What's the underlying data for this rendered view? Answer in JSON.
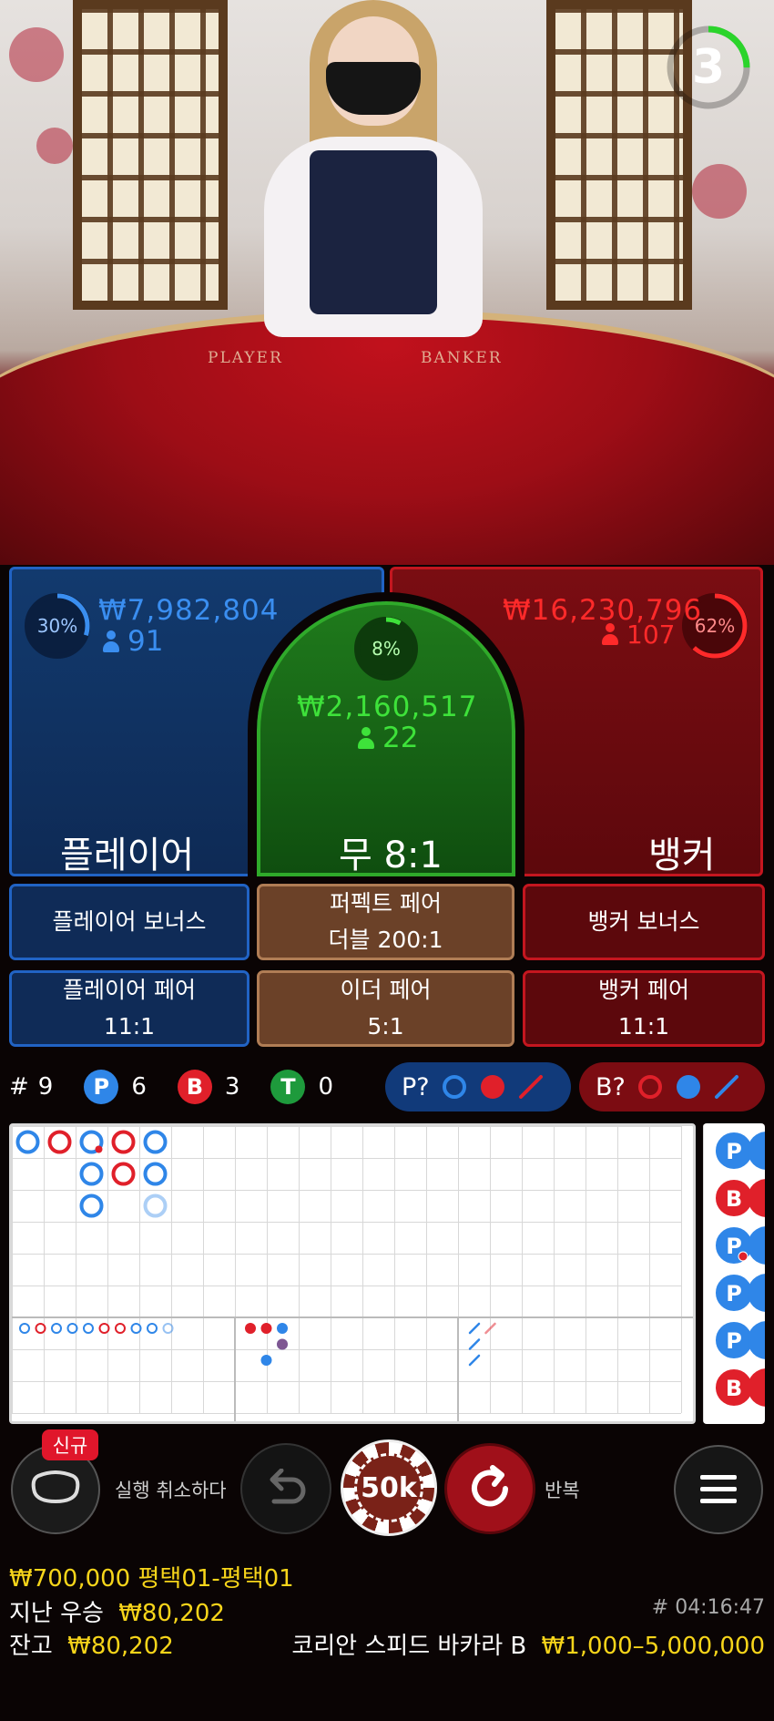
{
  "video": {
    "table_label_player": "PLAYER",
    "table_label_banker": "BANKER",
    "countdown": "3",
    "countdown_color": "#2bd42b"
  },
  "bets": {
    "player": {
      "name": "플레이어",
      "percent": "30%",
      "percent_value": 30,
      "amount": "₩7,982,804",
      "count": "91",
      "color": "#3a8ef0"
    },
    "tie": {
      "name": "무 8:1",
      "percent": "8%",
      "percent_value": 8,
      "amount": "₩2,160,517",
      "count": "22",
      "color": "#3ee23a"
    },
    "banker": {
      "name": "뱅커",
      "percent": "62%",
      "percent_value": 62,
      "amount": "₩16,230,796",
      "count": "107",
      "color": "#ff2a2a"
    }
  },
  "side_bets": [
    {
      "line1": "플레이어 보너스",
      "line2": ""
    },
    {
      "line1": "퍼펙트 페어",
      "line2": "더블 200:1"
    },
    {
      "line1": "뱅커 보너스",
      "line2": ""
    },
    {
      "line1": "플레이어 페어",
      "line2": "11:1"
    },
    {
      "line1": "이더 페어",
      "line2": "5:1"
    },
    {
      "line1": "뱅커 페어",
      "line2": "11:1"
    }
  ],
  "stats": {
    "round_symbol": "#",
    "round": "9",
    "player_letter": "P",
    "player_count": "6",
    "banker_letter": "B",
    "banker_count": "3",
    "tie_letter": "T",
    "tie_count": "0"
  },
  "predictions": {
    "player_label": "P?",
    "banker_label": "B?"
  },
  "colors": {
    "player": "#2f86e8",
    "banker": "#e0202a",
    "tie": "#1e9a3c",
    "gold": "#f7d51a"
  },
  "roadmap": {
    "big_road": [
      {
        "col": 0,
        "row": 0,
        "side": "P"
      },
      {
        "col": 1,
        "row": 0,
        "side": "B"
      },
      {
        "col": 2,
        "row": 0,
        "side": "P",
        "pair": "B"
      },
      {
        "col": 2,
        "row": 1,
        "side": "P"
      },
      {
        "col": 2,
        "row": 2,
        "side": "P"
      },
      {
        "col": 3,
        "row": 0,
        "side": "B"
      },
      {
        "col": 3,
        "row": 1,
        "side": "B"
      },
      {
        "col": 4,
        "row": 0,
        "side": "P"
      },
      {
        "col": 4,
        "row": 1,
        "side": "P"
      },
      {
        "col": 4,
        "row": 2,
        "side": "P",
        "faded": true
      }
    ],
    "bead_road": [
      "P",
      "P",
      "B",
      "P",
      "P"
    ],
    "bead_road_extra": [
      "P",
      "B"
    ]
  },
  "controls": {
    "new_badge": "신규",
    "undo_label": "실행 취소하다",
    "chip_value": "50k",
    "repeat_label": "반복"
  },
  "footer": {
    "bet_line": "₩700,000 평택01-평택01",
    "last_win_label": "지난 우승",
    "last_win_value": "₩80,202",
    "balance_label": "잔고",
    "balance_value": "₩80,202",
    "game_id": "# 04:16:47",
    "table_name": "코리안 스피드 바카라 B",
    "limits": "₩1,000–5,000,000"
  }
}
